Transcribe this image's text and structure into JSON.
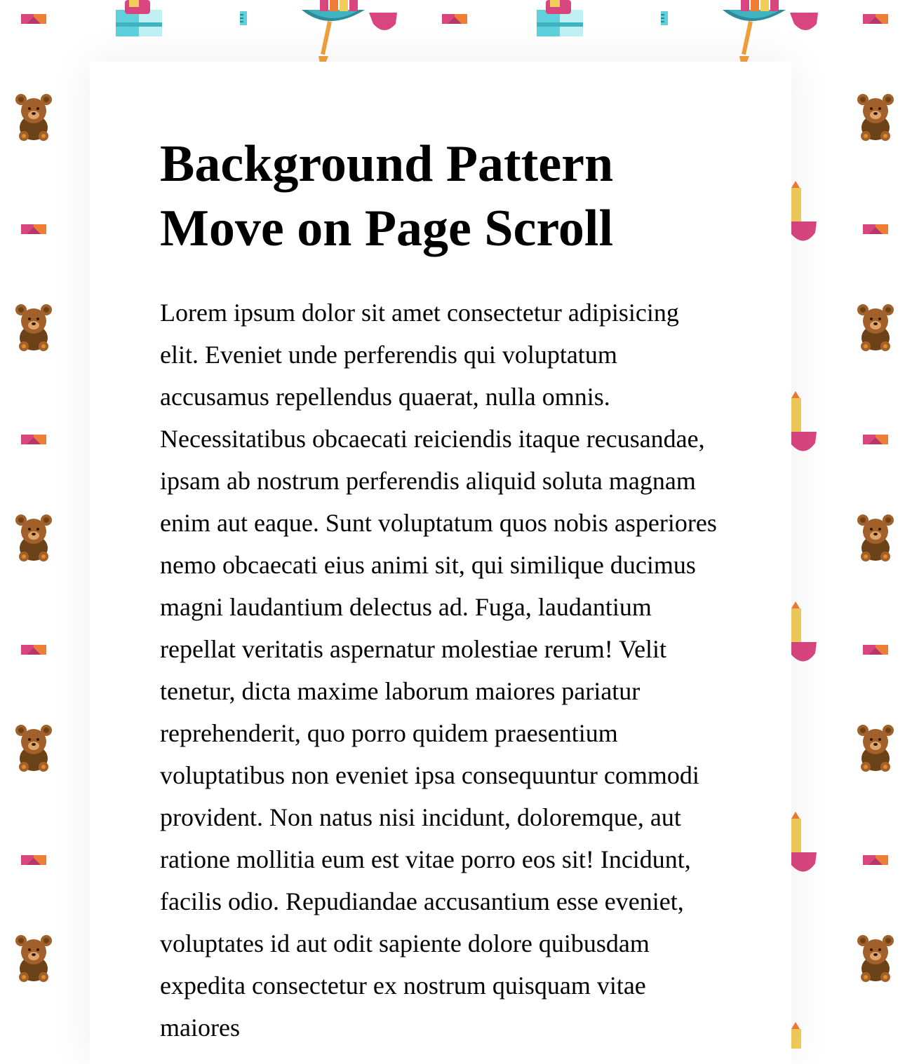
{
  "page": {
    "title": "Background Pattern Move on Page Scroll",
    "body": "Lorem ipsum dolor sit amet consectetur adipisicing elit. Eveniet unde perferendis qui voluptatum accusamus repellendus quaerat, nulla omnis. Necessitatibus obcaecati reiciendis itaque recusandae, ipsam ab nostrum perferendis aliquid soluta magnam enim aut eaque. Sunt voluptatum quos nobis asperiores nemo obcaecati eius animi sit, qui similique ducimus magni laudantium delectus ad. Fuga, laudantium repellat veritatis aspernatur molestiae rerum! Velit tenetur, dicta maxime laborum maiores pariatur reprehenderit, quo porro quidem praesentium voluptatibus non eveniet ipsa consequuntur commodi provident. Non natus nisi incidunt, doloremque, aut ratione mollitia eum est vitae porro eos sit! Incidunt, facilis odio. Repudiandae accusantium esse eveniet, voluptates id aut odit sapiente dolore quibusdam expedita consectetur ex nostrum quisquam vitae maiores"
  },
  "background": {
    "icons": [
      "teddy-bear-icon",
      "toy-blocks-icon",
      "toy-bucket-icon",
      "ruler-icon",
      "pinwheel-icon",
      "pencil-icon",
      "ice-cream-icon"
    ],
    "colors": {
      "bear_dark": "#6e4218",
      "bear_mid": "#a2612a",
      "bear_light": "#e38b2d",
      "pink": "#d9457f",
      "orange": "#f07d35",
      "teal": "#5fd1dc",
      "yellow": "#f2cd5c",
      "card": "#ffffff"
    }
  }
}
